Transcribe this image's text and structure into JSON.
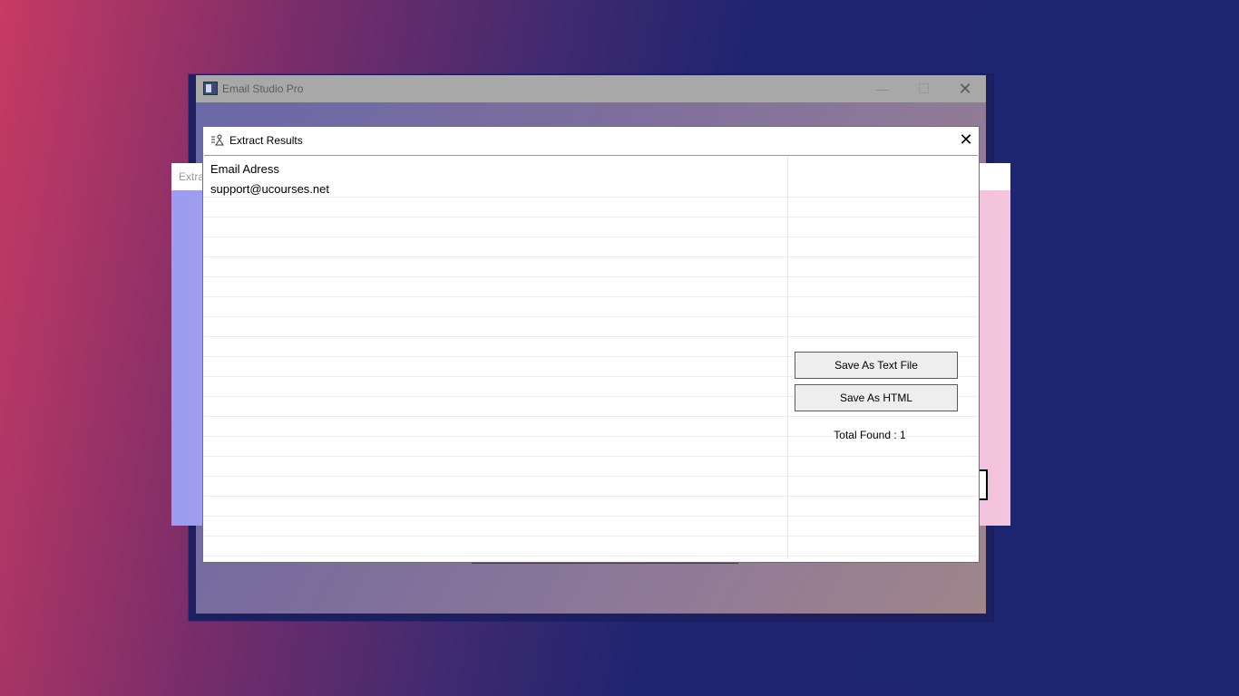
{
  "main_window": {
    "title": "Email Studio Pro",
    "minimize_symbol": "—",
    "close_symbol": "✕"
  },
  "background_panel": {
    "header_label": "Extra"
  },
  "dialog": {
    "title": "Extract Results",
    "close_symbol": "✕",
    "list": {
      "header": "Email Adress",
      "rows": [
        "support@ucourses.net"
      ]
    },
    "buttons": {
      "save_text": "Save As Text File",
      "save_html": "Save As HTML"
    },
    "total_found": "Total Found : 1"
  },
  "icons": [
    "app-icon",
    "extract-icon",
    "close-icon",
    "minimize-icon",
    "maximize-icon"
  ]
}
